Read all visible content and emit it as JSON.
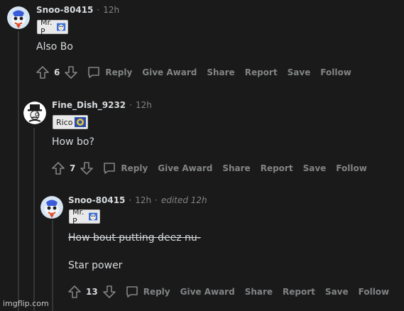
{
  "colors": {
    "background": "#1a1a1b",
    "text": "#d7dadc",
    "muted": "#818384",
    "thread_line": "#343536",
    "flair_bg": "#e9e9e9"
  },
  "comments": [
    {
      "username": "Snoo-80415",
      "separator": "·",
      "time": "12h",
      "edited": "",
      "flair": "Mr. P",
      "body": "Also Bo",
      "strike": "",
      "score": "6",
      "actions": {
        "reply": "Reply",
        "give_award": "Give Award",
        "share": "Share",
        "report": "Report",
        "save": "Save",
        "follow": "Follow"
      },
      "avatar": "snoo-avatar-icon"
    },
    {
      "username": "Fine_Dish_9232",
      "separator": "·",
      "time": "12h",
      "edited": "",
      "flair": "Rico",
      "body": "How bo?",
      "strike": "",
      "score": "7",
      "actions": {
        "reply": "Reply",
        "give_award": "Give Award",
        "share": "Share",
        "report": "Report",
        "save": "Save",
        "follow": "Follow"
      },
      "avatar": "monocle-man-avatar-icon"
    },
    {
      "username": "Snoo-80415",
      "separator": "·",
      "time": "12h",
      "edited_separator": "·",
      "edited": "edited 12h",
      "flair": "Mr. P",
      "strike": "How bout putting deez nu-",
      "body": "Star power",
      "score": "13",
      "actions": {
        "reply": "Reply",
        "give_award": "Give Award",
        "share": "Share",
        "report": "Report",
        "save": "Save",
        "follow": "Follow"
      },
      "avatar": "snoo-avatar-icon"
    }
  ],
  "watermark": "imgflip.com"
}
